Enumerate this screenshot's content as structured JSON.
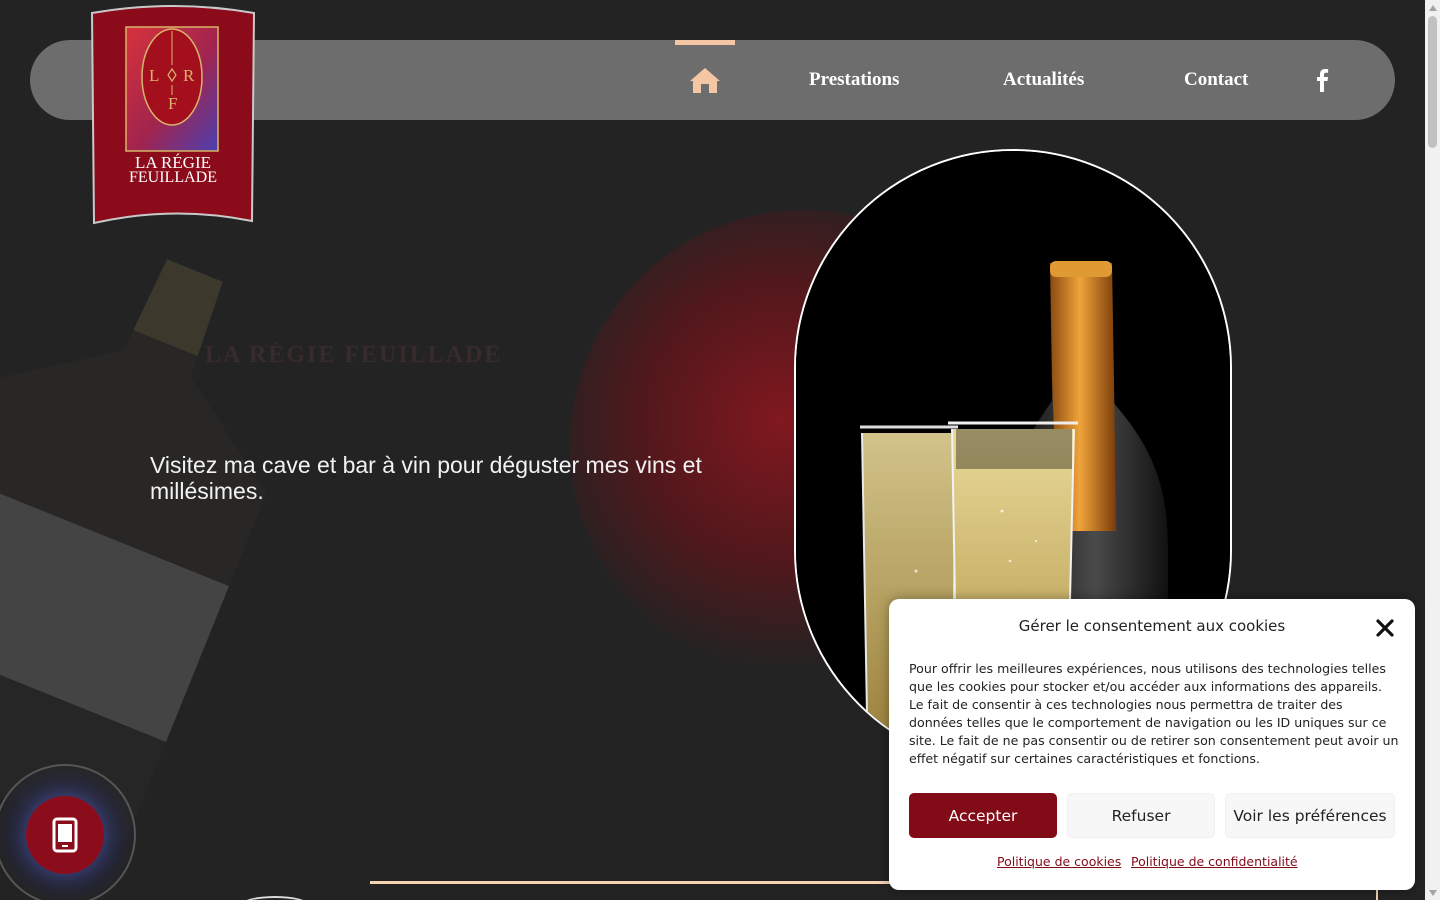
{
  "brand": {
    "logo_line1": "LA RÉGIE",
    "logo_line2": "FEUILLADE",
    "monogram_left": "L",
    "monogram_right": "R",
    "monogram_bottom": "F"
  },
  "nav": {
    "home_icon": "home-icon",
    "items": [
      {
        "label": "Prestations"
      },
      {
        "label": "Actualités"
      },
      {
        "label": "Contact"
      }
    ],
    "social_icon": "facebook-icon"
  },
  "hero": {
    "ghost_title": "LA RÉGIE FEUILLADE",
    "tagline": "Visitez ma cave et bar à vin pour déguster mes vins et millésimes."
  },
  "phone_button": {
    "icon": "phone-icon"
  },
  "cookie_banner": {
    "title": "Gérer le consentement aux cookies",
    "body": "Pour offrir les meilleures expériences, nous utilisons des technologies telles que les cookies pour stocker et/ou accéder aux informations des appareils. Le fait de consentir à ces technologies nous permettra de traiter des données telles que le comportement de navigation ou les ID uniques sur ce site. Le fait de ne pas consentir ou de retirer son consentement peut avoir un effet négatif sur certaines caractéristiques et fonctions.",
    "accept_label": "Accepter",
    "refuse_label": "Refuser",
    "prefs_label": "Voir les préférences",
    "cookie_policy_label": "Politique de cookies",
    "privacy_policy_label": "Politique de confidentialité"
  },
  "colors": {
    "background": "#232323",
    "nav_bar": "#6d6d6d",
    "accent_peach": "#f4c6a3",
    "brand_red": "#820b18"
  }
}
